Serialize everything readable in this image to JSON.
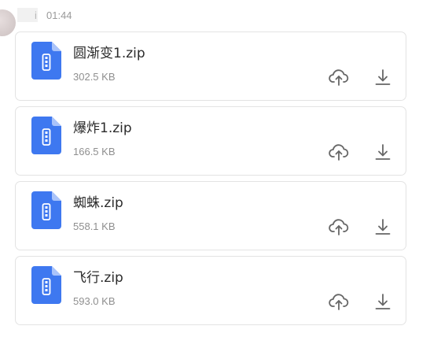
{
  "message": {
    "sender_name": "i",
    "timestamp": "01:44"
  },
  "files": [
    {
      "name": "圆渐变1.zip",
      "size": "302.5 KB",
      "icon": "zip-file-icon"
    },
    {
      "name": "爆炸1.zip",
      "size": "166.5 KB",
      "icon": "zip-file-icon"
    },
    {
      "name": "蜘蛛.zip",
      "size": "558.1 KB",
      "icon": "zip-file-icon"
    },
    {
      "name": "飞行.zip",
      "size": "593.0 KB",
      "icon": "zip-file-icon"
    }
  ],
  "actions": {
    "upload_icon": "cloud-upload-icon",
    "download_icon": "download-icon"
  },
  "colors": {
    "file_icon": "#3e78f0",
    "action_icon": "#666666",
    "card_border": "#e3e3e3"
  }
}
